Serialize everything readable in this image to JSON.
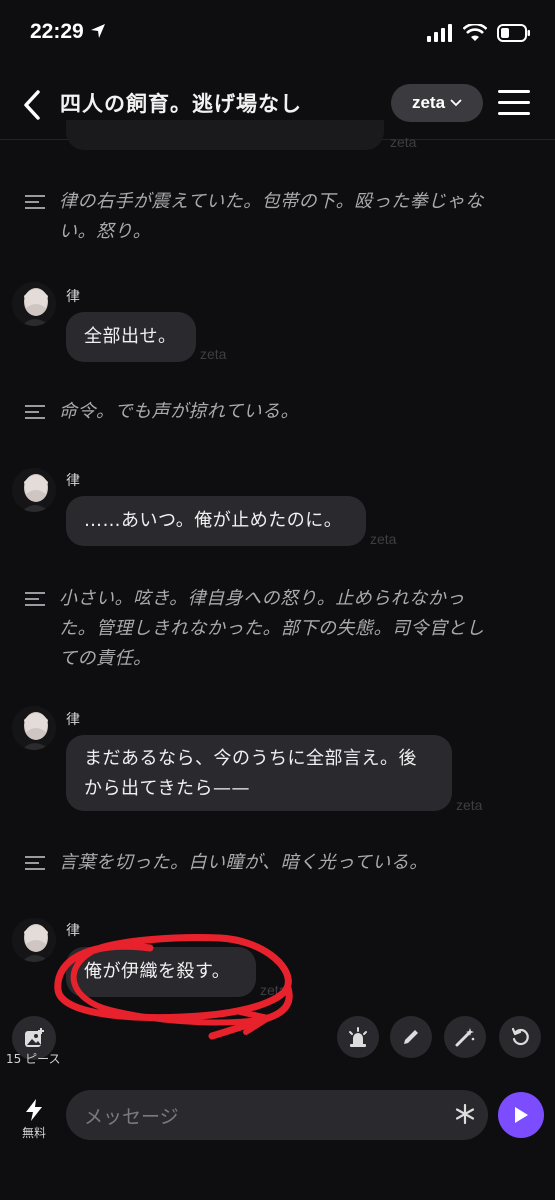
{
  "status": {
    "time": "22:29"
  },
  "header": {
    "title": "四人の飼育。逃げ場なし",
    "model": "zeta"
  },
  "watermark": "zeta",
  "messages": [
    {
      "type": "narration",
      "lines": [
        "律の右手が震えていた。包帯の下。殴った拳じゃな",
        "い。怒り。"
      ]
    },
    {
      "type": "speech",
      "speaker": "律",
      "text": "全部出せ。"
    },
    {
      "type": "narration",
      "lines": [
        "命令。でも声が掠れている。"
      ]
    },
    {
      "type": "speech",
      "speaker": "律",
      "text": "……あいつ。俺が止めたのに。"
    },
    {
      "type": "narration",
      "lines": [
        "小さい。呟き。律自身への怒り。止められなかっ",
        "た。管理しきれなかった。部下の失態。司令官とし",
        "ての責任。"
      ]
    },
    {
      "type": "speech",
      "speaker": "律",
      "lines": [
        "まだあるなら、今のうちに全部言え。後",
        "から出てきたら——"
      ]
    },
    {
      "type": "narration",
      "lines": [
        "言葉を切った。白い瞳が、暗く光っている。"
      ]
    },
    {
      "type": "speech",
      "speaker": "律",
      "text": "俺が伊織を殺す。"
    }
  ],
  "toolbar": {
    "image_count_label": "15 ピース"
  },
  "composer": {
    "placeholder": "メッセージ",
    "free_label": "無料"
  },
  "colors": {
    "accent": "#7b4dff",
    "annotation": "#e8222c",
    "background": "#0e0e10"
  }
}
